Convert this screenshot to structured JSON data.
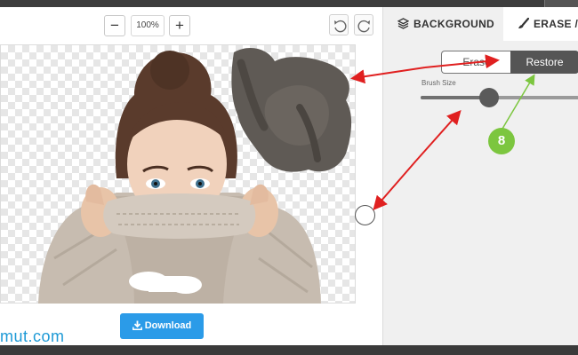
{
  "toolbar": {
    "zoom_out_label": "−",
    "zoom_level": "100%",
    "zoom_in_label": "+",
    "undo_icon": "undo-icon",
    "redo_icon": "redo-icon"
  },
  "tabs": {
    "background_label": "BACKGROUND",
    "background_icon": "layers-icon",
    "erase_label": "ERASE / RESTORE",
    "erase_icon": "brush-icon"
  },
  "mode_toggle": {
    "erase_label": "Erase",
    "restore_label": "Restore",
    "selected": "Restore"
  },
  "brush_size": {
    "label": "Brush Size",
    "value_fraction": 0.43
  },
  "download": {
    "label": "Download",
    "icon": "download-icon",
    "color": "#2b9be8"
  },
  "watermark_text": "mut.com",
  "annotation": {
    "step_number": "8",
    "arrow_color": "#e02020",
    "step_color": "#7cc63f"
  }
}
